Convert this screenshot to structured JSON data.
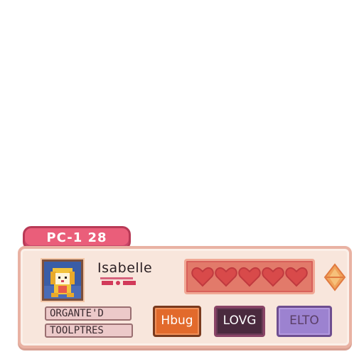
{
  "tab": {
    "label": "PC-1 28"
  },
  "player": {
    "name": "Isabelle"
  },
  "tags": [
    "ORGANTE'D",
    "TOOLPTRES"
  ],
  "buttons": {
    "hbug": "Hbug",
    "love": "LOVG",
    "third": "ELTO"
  },
  "hearts": {
    "count": 5
  },
  "icons": {
    "avatar": "dog-portrait-icon",
    "heart": "heart-icon",
    "gem": "diamond-gem-icon"
  },
  "colors": {
    "tab": "#ea5e7a",
    "panel": "#f8e6dc",
    "heart": "#d84a4a",
    "accent": "#e26a2c",
    "love": "#4a2a3e",
    "third": "#9c82d0"
  }
}
